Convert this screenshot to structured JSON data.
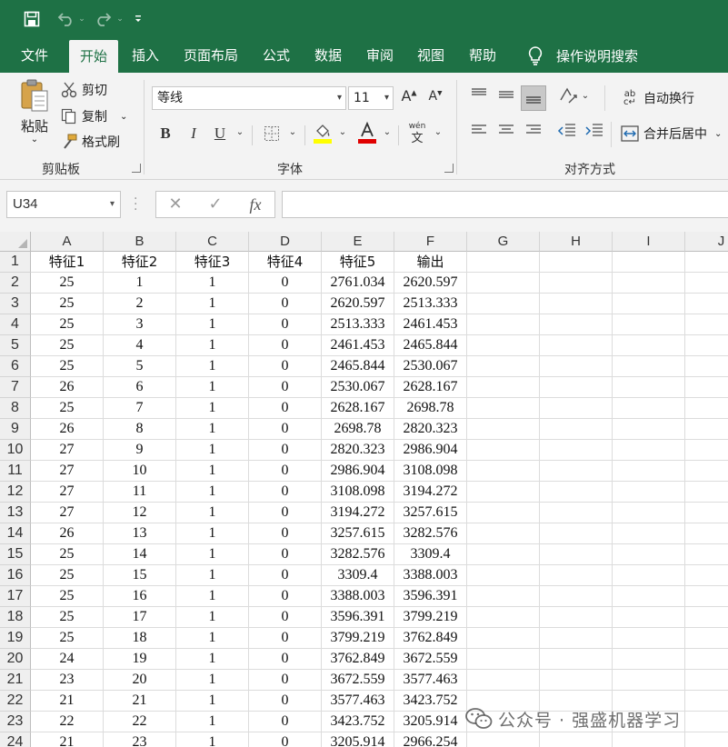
{
  "quick_access": {
    "save": "save-icon",
    "undo": "undo-icon",
    "redo": "redo-icon",
    "more": "customize-qat-icon"
  },
  "tabs": [
    "文件",
    "开始",
    "插入",
    "页面布局",
    "公式",
    "数据",
    "审阅",
    "视图",
    "帮助"
  ],
  "active_tab": "开始",
  "tell_me": "操作说明搜索",
  "clipboard": {
    "paste": "粘贴",
    "cut": "剪切",
    "copy": "复制",
    "format_painter": "格式刷",
    "group_label": "剪贴板"
  },
  "font": {
    "name": "等线",
    "size": "11",
    "grow": "A",
    "shrink": "A",
    "bold": "B",
    "italic": "I",
    "underline": "U",
    "phonetic_top": "wén",
    "phonetic_bottom": "文",
    "group_label": "字体"
  },
  "alignment": {
    "wrap_text": "自动换行",
    "merge_center": "合并后居中",
    "group_label": "对齐方式"
  },
  "formula_bar": {
    "name_box": "U34",
    "cancel": "✕",
    "enter": "✓",
    "fx": "fx",
    "value": ""
  },
  "columns": [
    "A",
    "B",
    "C",
    "D",
    "E",
    "F",
    "G",
    "H",
    "I",
    "J"
  ],
  "rows": [
    [
      "1",
      "特征1",
      "特征2",
      "特征3",
      "特征4",
      "特征5",
      "输出"
    ],
    [
      "2",
      "25",
      "1",
      "1",
      "0",
      "2761.034",
      "2620.597"
    ],
    [
      "3",
      "25",
      "2",
      "1",
      "0",
      "2620.597",
      "2513.333"
    ],
    [
      "4",
      "25",
      "3",
      "1",
      "0",
      "2513.333",
      "2461.453"
    ],
    [
      "5",
      "25",
      "4",
      "1",
      "0",
      "2461.453",
      "2465.844"
    ],
    [
      "6",
      "25",
      "5",
      "1",
      "0",
      "2465.844",
      "2530.067"
    ],
    [
      "7",
      "26",
      "6",
      "1",
      "0",
      "2530.067",
      "2628.167"
    ],
    [
      "8",
      "25",
      "7",
      "1",
      "0",
      "2628.167",
      "2698.78"
    ],
    [
      "9",
      "26",
      "8",
      "1",
      "0",
      "2698.78",
      "2820.323"
    ],
    [
      "10",
      "27",
      "9",
      "1",
      "0",
      "2820.323",
      "2986.904"
    ],
    [
      "11",
      "27",
      "10",
      "1",
      "0",
      "2986.904",
      "3108.098"
    ],
    [
      "12",
      "27",
      "11",
      "1",
      "0",
      "3108.098",
      "3194.272"
    ],
    [
      "13",
      "27",
      "12",
      "1",
      "0",
      "3194.272",
      "3257.615"
    ],
    [
      "14",
      "26",
      "13",
      "1",
      "0",
      "3257.615",
      "3282.576"
    ],
    [
      "15",
      "25",
      "14",
      "1",
      "0",
      "3282.576",
      "3309.4"
    ],
    [
      "16",
      "25",
      "15",
      "1",
      "0",
      "3309.4",
      "3388.003"
    ],
    [
      "17",
      "25",
      "16",
      "1",
      "0",
      "3388.003",
      "3596.391"
    ],
    [
      "18",
      "25",
      "17",
      "1",
      "0",
      "3596.391",
      "3799.219"
    ],
    [
      "19",
      "25",
      "18",
      "1",
      "0",
      "3799.219",
      "3762.849"
    ],
    [
      "20",
      "24",
      "19",
      "1",
      "0",
      "3762.849",
      "3672.559"
    ],
    [
      "21",
      "23",
      "20",
      "1",
      "0",
      "3672.559",
      "3577.463"
    ],
    [
      "22",
      "21",
      "21",
      "1",
      "0",
      "3577.463",
      "3423.752"
    ],
    [
      "23",
      "22",
      "22",
      "1",
      "0",
      "3423.752",
      "3205.914"
    ],
    [
      "24",
      "21",
      "23",
      "1",
      "0",
      "3205.914",
      "2966.254"
    ]
  ],
  "watermark": "公众号 · 强盛机器学习",
  "colors": {
    "excel_green": "#1e7145",
    "ribbon_bg": "#f3f3f3",
    "highlight_yellow": "#ffff00",
    "font_red": "#e00000"
  }
}
